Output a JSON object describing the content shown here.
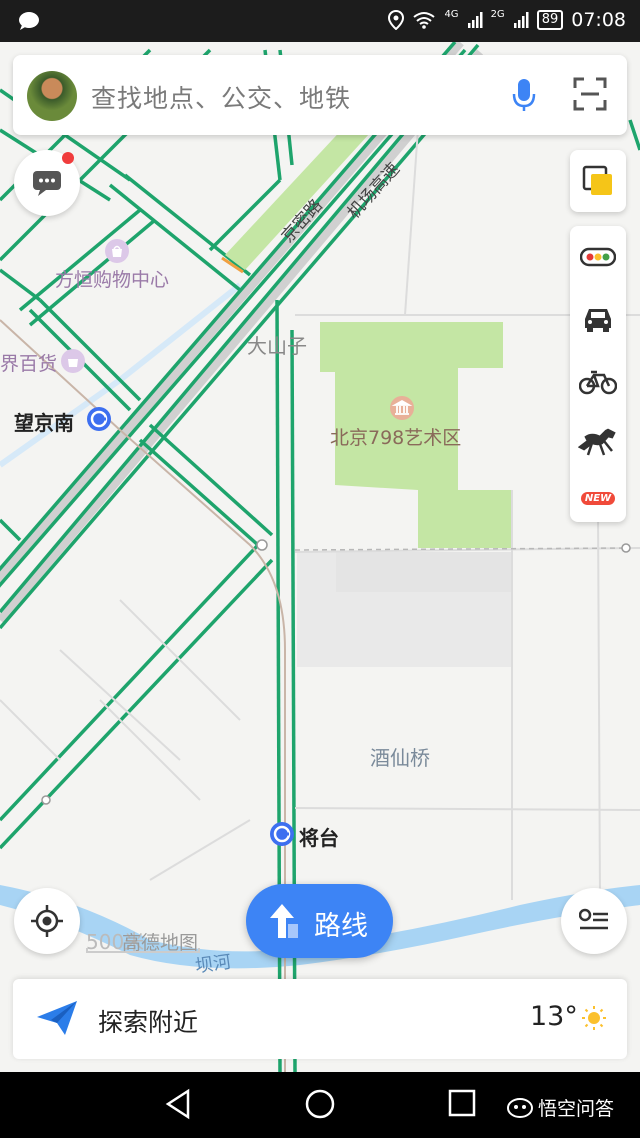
{
  "status_bar": {
    "network_4g": "4G",
    "network_2g": "2G",
    "battery": "89",
    "time": "07:08"
  },
  "search": {
    "placeholder": "查找地点、公交、地铁"
  },
  "map": {
    "labels": {
      "fangheng": "方恒购物中心",
      "jiebaihuo": "界百货",
      "wangjingnan": "望京南",
      "dashanzi": "大山子",
      "art798": "北京798艺术区",
      "jiuxianqiao": "酒仙桥",
      "jiangtai": "将台",
      "bahe": "坝河",
      "jingmi_road": "京密路",
      "airport_road": "机场高速"
    },
    "colors": {
      "road": "#1ea46c",
      "park": "#c4e6a4",
      "water": "#a8d4f4",
      "background": "#f4f4f2"
    }
  },
  "route_button": {
    "label": "路线"
  },
  "map_footer": {
    "scale": "500米",
    "watermark": "高德地图"
  },
  "explore": {
    "label": "探索附近",
    "temperature": "13°"
  },
  "right_panel": {
    "new_badge": "NEW"
  },
  "nav_bar": {
    "brand": "悟空问答"
  },
  "icons": [
    "message-icon",
    "microphone-icon",
    "scan-icon",
    "layers-icon",
    "traffic-light-icon",
    "taxi-icon",
    "bike-icon",
    "horse-icon",
    "locate-icon",
    "route-arrow-icon",
    "list-icon",
    "paper-plane-icon",
    "sun-icon",
    "back-icon",
    "home-icon",
    "recent-apps-icon",
    "subway-icon",
    "shopping-icon",
    "museum-icon"
  ]
}
